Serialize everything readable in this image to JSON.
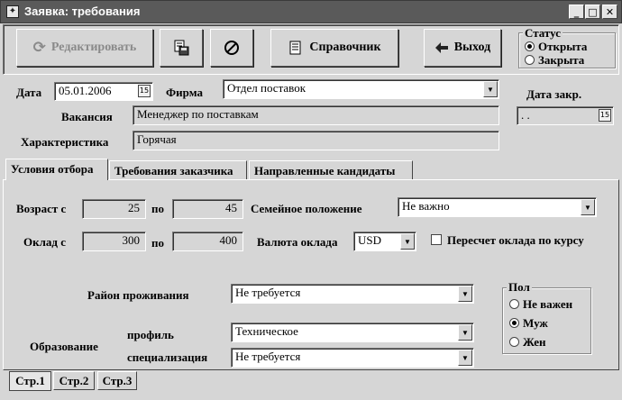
{
  "window": {
    "title": "Заявка: требования",
    "minimize": "_",
    "maximize": "□",
    "close": "✕"
  },
  "toolbar": {
    "edit_label": "Редактировать",
    "reference_label": "Справочник",
    "exit_label": "Выход"
  },
  "status": {
    "title": "Статус",
    "options": [
      "Открыта",
      "Закрыта"
    ],
    "selected": "Открыта"
  },
  "header": {
    "date_label": "Дата",
    "date_value": "05.01.2006",
    "firm_label": "Фирма",
    "firm_value": "Отдел поставок",
    "close_date_label": "Дата закр.",
    "close_date_value": ". .",
    "vacancy_label": "Вакансия",
    "vacancy_value": "Менеджер по поставкам",
    "characteristic_label": "Характеристика",
    "characteristic_value": "Горячая"
  },
  "tabs": [
    "Условия отбора",
    "Требования заказчика",
    "Направленные кандидаты"
  ],
  "active_tab": "Условия отбора",
  "conditions": {
    "age_label": "Возраст с",
    "age_from": "25",
    "to_label": "по",
    "age_to": "45",
    "marital_label": "Семейное положение",
    "marital_value": "Не важно",
    "salary_label": "Оклад с",
    "salary_from": "300",
    "salary_to": "400",
    "currency_label": "Валюта оклада",
    "currency_value": "USD",
    "recalc_label": "Пересчет оклада по курсу",
    "district_label": "Район проживания",
    "district_value": "Не требуется",
    "education_label": "Образование",
    "profile_label": "профиль",
    "profile_value": "Техническое",
    "specialization_label": "специализация",
    "specialization_value": "Не требуется"
  },
  "gender": {
    "title": "Пол",
    "options": [
      "Не важен",
      "Муж",
      "Жен"
    ],
    "selected": "Муж"
  },
  "pages": [
    "Стр.1",
    "Стр.2",
    "Стр.3"
  ],
  "active_page": "Стр.1",
  "icons": {
    "app": "app-icon",
    "edit": "refresh-icon",
    "save": "save-icon",
    "cancel": "cancel-icon",
    "reference": "book-icon",
    "exit": "exit-arrow-icon",
    "calendar": "calendar-icon",
    "dropdown": "chevron-down-icon"
  }
}
